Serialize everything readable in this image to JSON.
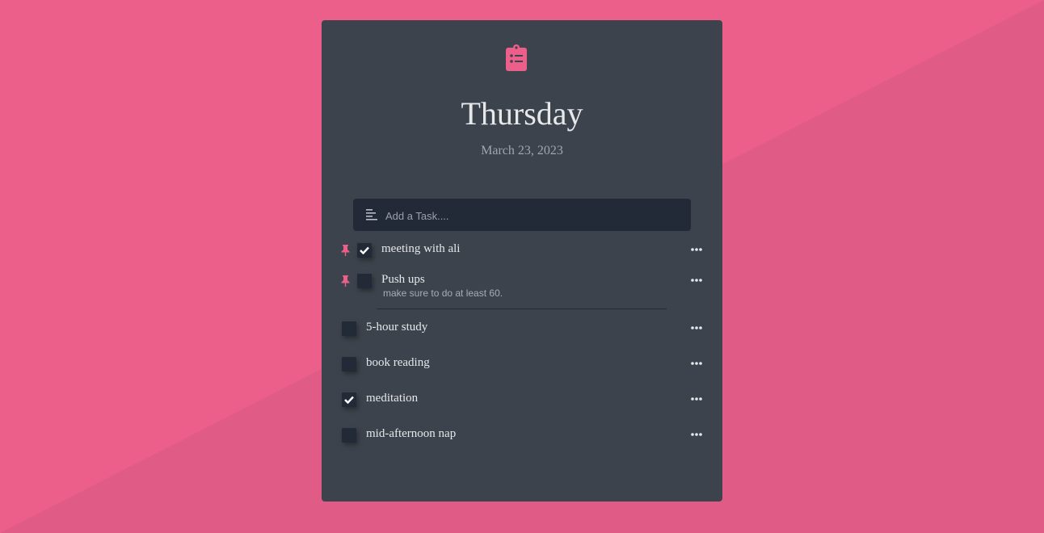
{
  "colors": {
    "background": "#ec5f8b",
    "card": "#3d434c",
    "accent": "#ec5f8b",
    "input_bg": "#222a38"
  },
  "header": {
    "day": "Thursday",
    "date": "March 23, 2023",
    "logo_icon": "clipboard-list-icon"
  },
  "add_task": {
    "placeholder": "Add a Task....",
    "icon": "align-left-icon"
  },
  "pinned_tasks": [
    {
      "label": "meeting with ali",
      "done": true,
      "note": ""
    },
    {
      "label": "Push ups",
      "done": false,
      "note": "make sure to do at least 60."
    }
  ],
  "tasks": [
    {
      "label": "5-hour study",
      "done": false
    },
    {
      "label": "book reading",
      "done": false
    },
    {
      "label": "meditation",
      "done": true
    },
    {
      "label": "mid-afternoon nap",
      "done": false
    }
  ]
}
